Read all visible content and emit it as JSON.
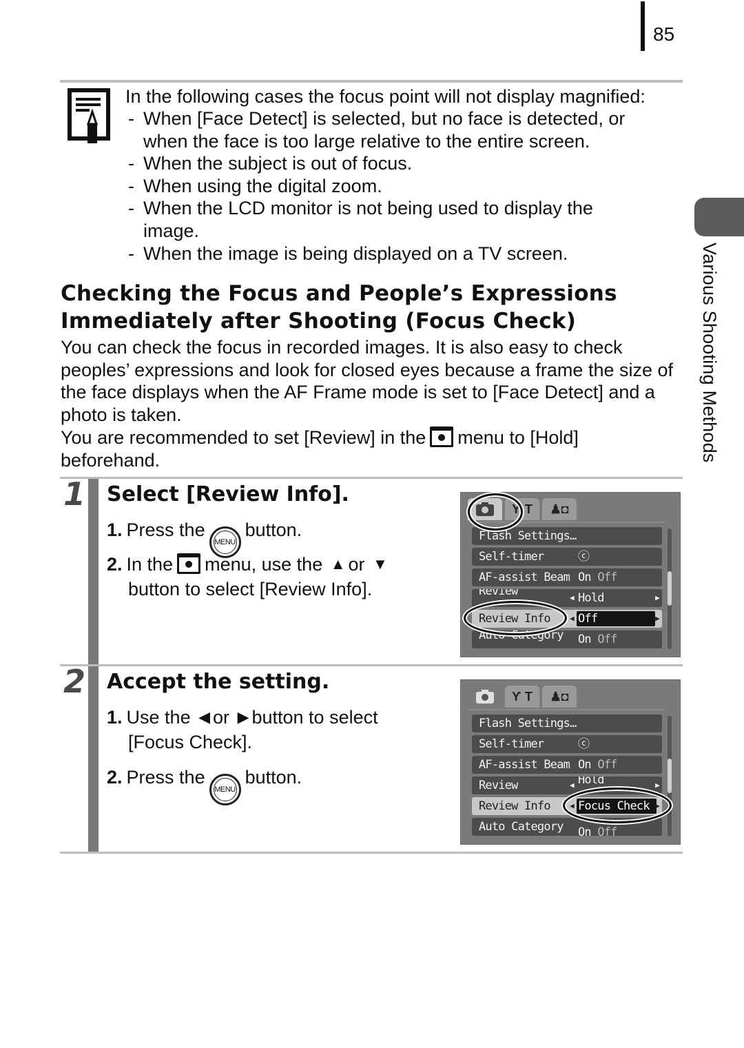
{
  "page": {
    "number": "85",
    "side_label": "Various Shooting Methods"
  },
  "note": {
    "icon": "memo-pencil-icon",
    "intro": "In the following cases the focus point will not display magnified:",
    "items": [
      "When [Face Detect] is selected, but no face is detected, or when the face is too large relative to the entire screen.",
      "When the subject is out of focus.",
      "When using the digital zoom.",
      "When the LCD monitor is not being used to display the image.",
      "When the image is being displayed on a TV screen."
    ],
    "dash": "-"
  },
  "section": {
    "title_line1": "Checking the Focus and People’s Expressions",
    "title_line2": "Immediately after Shooting (Focus Check)",
    "paragraph1": "You can check the focus in recorded images. It is also easy to check peoples’ expressions and look for closed eyes because a frame the size of the face displays when the AF Frame mode is set to [Face Detect] and a photo is taken.",
    "paragraph2_before": "You are recommended to set [Review] in the",
    "paragraph2_after": "menu to [Hold] beforehand."
  },
  "steps": [
    {
      "number": "1",
      "title": "Select [Review Info].",
      "substeps": [
        {
          "num": "1.",
          "before": "Press the",
          "button": "MENU",
          "after": "button."
        },
        {
          "num": "2.",
          "before": "In the",
          "middle": "menu, use the",
          "or": "or",
          "line2": "button to select [Review Info]."
        }
      ],
      "screen": {
        "tabs": [
          "camera-tab",
          "tools-tab",
          "my-camera-tab"
        ],
        "active_tab": 0,
        "rows": [
          {
            "label": "Flash Settings…",
            "value": ""
          },
          {
            "label": "Self-timer",
            "value": "ⓒ"
          },
          {
            "label": "AF-assist Beam",
            "value_on": "On",
            "value_off": "Off"
          },
          {
            "label": "Review",
            "value": "Hold"
          },
          {
            "label": "Review Info",
            "value": "Off"
          },
          {
            "label": "Auto Category",
            "value_on": "On",
            "value_off": "Off"
          }
        ]
      }
    },
    {
      "number": "2",
      "title": "Accept the setting.",
      "substeps": [
        {
          "num": "1.",
          "before": "Use the",
          "or": "or",
          "after": "button to select",
          "line2": "[Focus Check]."
        },
        {
          "num": "2.",
          "before": "Press the",
          "button": "MENU",
          "after": "button."
        }
      ],
      "screen": {
        "tabs": [
          "camera-tab",
          "tools-tab",
          "my-camera-tab"
        ],
        "active_tab": 0,
        "rows": [
          {
            "label": "Flash Settings…",
            "value": ""
          },
          {
            "label": "Self-timer",
            "value": "ⓒ"
          },
          {
            "label": "AF-assist Beam",
            "value_on": "On",
            "value_off": "Off"
          },
          {
            "label": "Review",
            "value": "Hold"
          },
          {
            "label": "Review Info",
            "value": "Focus Check"
          },
          {
            "label": "Auto Category",
            "value_on": "On",
            "value_off": "Off"
          }
        ]
      }
    }
  ],
  "icons": {
    "up": "▲",
    "down": "▼",
    "left": "◀",
    "right": "▶",
    "tab_tools": "Ƴ T",
    "tab_mycam": "♟◘"
  }
}
